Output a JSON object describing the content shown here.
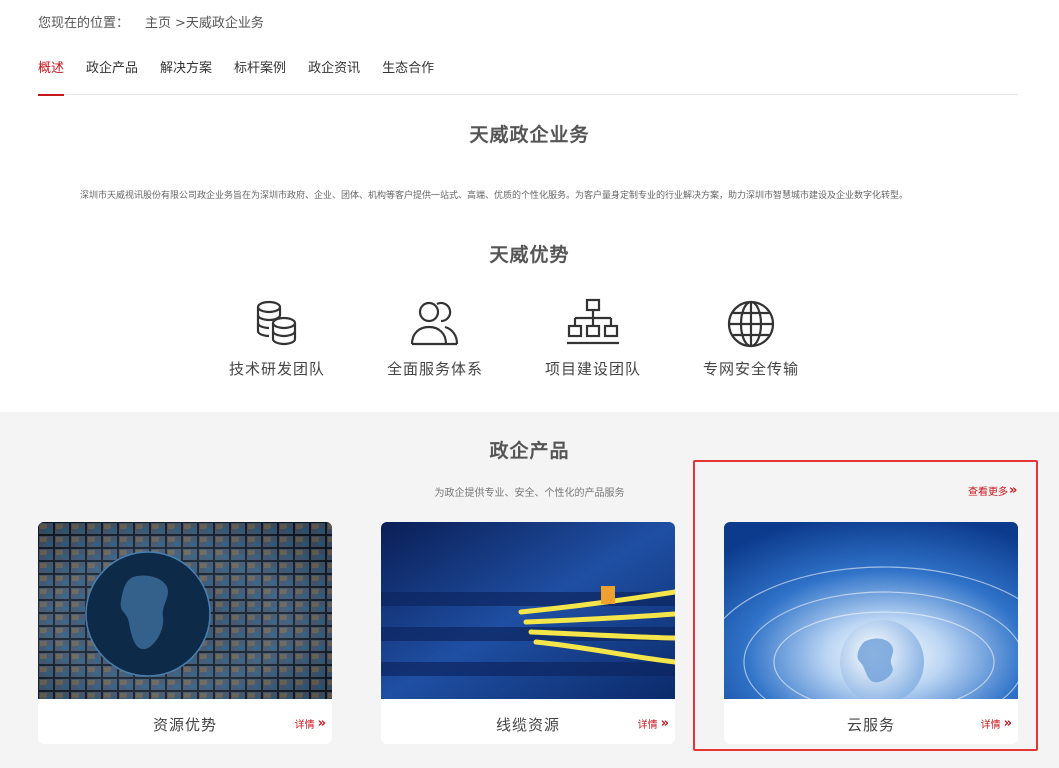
{
  "breadcrumb": {
    "prefix": "您现在的位置：",
    "home": "主页",
    "current": ">天威政企业务"
  },
  "tabs": [
    {
      "label": "概述",
      "active": true
    },
    {
      "label": "政企产品",
      "active": false
    },
    {
      "label": "解决方案",
      "active": false
    },
    {
      "label": "标杆案例",
      "active": false
    },
    {
      "label": "政企资讯",
      "active": false
    },
    {
      "label": "生态合作",
      "active": false
    }
  ],
  "overview": {
    "title": "天威政企业务",
    "intro": "深圳市天威视讯股份有限公司政企业务旨在为深圳市政府、企业、团体、机构等客户提供一站式、高端、优质的个性化服务。为客户量身定制专业的行业解决方案，助力深圳市智慧城市建设及企业数字化转型。"
  },
  "advantages": {
    "title": "天威优势",
    "items": [
      {
        "label": "技术研发团队",
        "icon": "database-icon"
      },
      {
        "label": "全面服务体系",
        "icon": "users-icon"
      },
      {
        "label": "项目建设团队",
        "icon": "org-chart-icon"
      },
      {
        "label": "专网安全传输",
        "icon": "globe-icon"
      }
    ]
  },
  "products": {
    "title": "政企产品",
    "subtitle": "为政企提供专业、安全、个性化的产品服务",
    "more_label": "查看更多",
    "cards": [
      {
        "name": "资源优势",
        "detail": "详情"
      },
      {
        "name": "线缆资源",
        "detail": "详情"
      },
      {
        "name": "云服务",
        "detail": "详情"
      }
    ]
  },
  "colors": {
    "accent": "#c8161d",
    "highlight": "#e53434",
    "section_bg": "#f4f4f4"
  }
}
